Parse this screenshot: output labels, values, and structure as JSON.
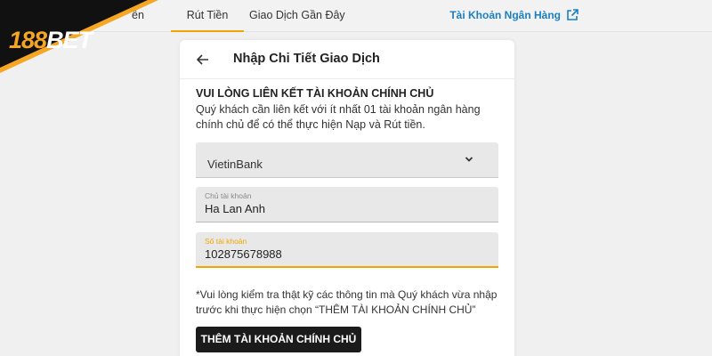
{
  "nav": {
    "tabs": [
      {
        "label": "ền",
        "active": false
      },
      {
        "label": "Rút Tiền",
        "active": true
      },
      {
        "label": "Giao Dịch Gần Đây",
        "active": false
      }
    ],
    "bank_link": {
      "label": "Tài Khoản Ngân Hàng",
      "icon": "external-link-icon"
    },
    "accent_color": "#f0a500",
    "link_color": "#1b7fc4"
  },
  "logo": {
    "number": "188",
    "word": "BET",
    "colors": {
      "background": "#111111",
      "number": "#f5a623",
      "border": "#f5a623"
    }
  },
  "card": {
    "back_icon": "arrow-left-icon",
    "title": "Nhập Chi Tiết Giao Dịch",
    "notice_title": "VUI LÒNG LIÊN KẾT TÀI KHOẢN CHÍNH CHỦ",
    "notice_body": "Quý khách cần liên kết với ít nhất 01 tài khoản ngân hàng chính chủ để có thể thực hiện Nạp và Rút tiền.",
    "bank_select": {
      "value": "VietinBank",
      "icon": "chevron-down-icon"
    },
    "holder_field": {
      "label": "Chủ tài khoản",
      "value": "Ha Lan Anh"
    },
    "number_field": {
      "label": "Số tài khoản",
      "value": "102875678988"
    },
    "note": "*Vui lòng kiểm tra thật kỹ các thông tin mà Quý khách vừa nhập trước khi thực hiện chọn “THÊM TÀI KHOẢN CHÍNH CHỦ”",
    "submit_label": "THÊM TÀI KHOẢN CHÍNH CHỦ"
  }
}
